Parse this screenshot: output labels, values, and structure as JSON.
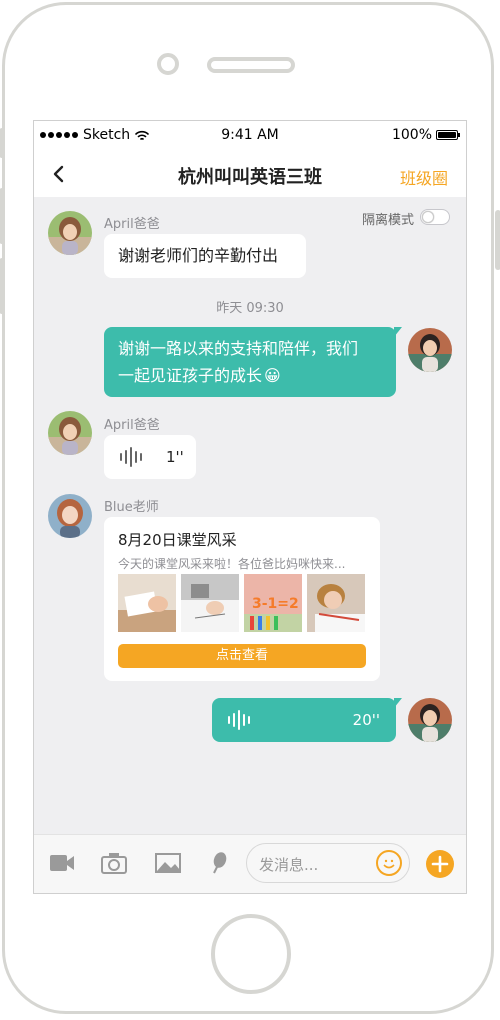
{
  "status_bar": {
    "carrier": "Sketch",
    "time": "9:41 AM",
    "battery": "100%"
  },
  "nav": {
    "title": "杭州叫叫英语三班",
    "right_link": "班级圈"
  },
  "isolation_toggle": {
    "label": "隔离模式"
  },
  "messages": [
    {
      "sender": "April爸爸",
      "text": "谢谢老师们的辛勤付出"
    },
    {
      "timestamp": "昨天 09:30"
    },
    {
      "line1": "谢谢一路以来的支持和陪伴，我们",
      "line2": "一起见证孩子的成长",
      "emoji": "😀"
    },
    {
      "sender": "April爸爸",
      "voice_duration": "1''"
    },
    {
      "sender": "Blue老师",
      "card_title": "8月20日课堂风采",
      "card_subtitle": "今天的课堂风采来啦！各位爸比妈咪快来...",
      "card_button": "点击查看"
    },
    {
      "voice_duration": "20''"
    }
  ],
  "input": {
    "placeholder": "发消息..."
  },
  "colors": {
    "accent": "#f5a623",
    "bubble_teal": "#3dbcab",
    "background": "#efeff1"
  },
  "icons": [
    "back-icon",
    "wifi-icon",
    "battery-icon",
    "video-icon",
    "camera-icon",
    "image-icon",
    "microphone-icon",
    "emoji-icon",
    "plus-icon",
    "voice-wave-icon"
  ]
}
